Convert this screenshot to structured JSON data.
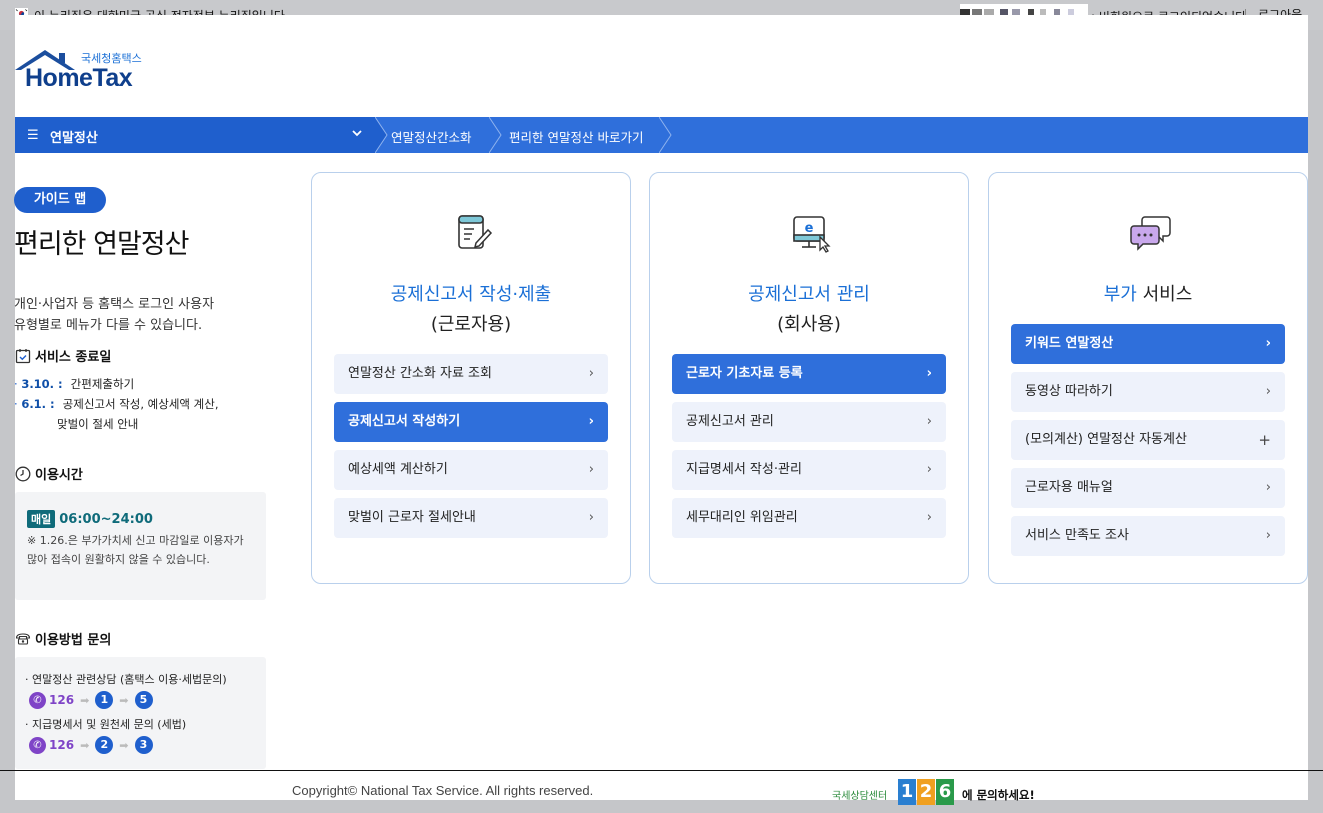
{
  "gov_bar": {
    "notice": "이 누리집은 대한민국 공식 전자정부 누리집입니다.",
    "user_status": ": 비회원으로 로그인되었습니다.",
    "logout": "로그아웃"
  },
  "logo": {
    "sub": "국세청홈택스",
    "main": "HomeTax"
  },
  "nav": {
    "menu_label": "연말정산",
    "breadcrumbs": [
      "연말정산간소화",
      "편리한 연말정산 바로가기"
    ]
  },
  "sidebar": {
    "guide_badge": "가이드 맵",
    "page_title": "편리한 연말정산",
    "intro_line1": "개인·사업자 등 홈택스 로그인 사용자",
    "intro_line2": "유형별로 메뉴가 다를 수 있습니다.",
    "service_end": {
      "heading": "서비스 종료일",
      "items": [
        {
          "date": "3.10. :",
          "text": "간편제출하기"
        },
        {
          "date": "6.1. :",
          "text": "공제신고서 작성, 예상세액 계산,",
          "text2": "맞벌이 절세 안내"
        }
      ]
    },
    "usage_time": {
      "heading": "이용시간",
      "daily_badge": "매일",
      "hours": "06:00~24:00",
      "note": "※ 1.26.은 부가가치세 신고 마감일로 이용자가 많아 접속이 원활하지 않을 수 있습니다."
    },
    "inquiry": {
      "heading": "이용방법 문의",
      "items": [
        {
          "text": "연말정산 관련상담 (홈택스 이용·세법문의)",
          "phone": "126",
          "steps": [
            "1",
            "5"
          ]
        },
        {
          "text": "지급명세서 및 원천세 문의 (세법)",
          "phone": "126",
          "steps": [
            "2",
            "3"
          ]
        }
      ]
    }
  },
  "cards": [
    {
      "icon": "document-edit-icon",
      "title_highlight": "공제신고서 작성·제출",
      "title_sub": "(근로자용)",
      "items": [
        {
          "label": "연말정산 간소화 자료 조회",
          "active": false
        },
        {
          "label": "공제신고서 작성하기",
          "active": true
        },
        {
          "label": "예상세액 계산하기",
          "active": false
        },
        {
          "label": "맞벌이 근로자 절세안내",
          "active": false
        }
      ]
    },
    {
      "icon": "monitor-e-icon",
      "title_highlight": "공제신고서 관리",
      "title_sub": "(회사용)",
      "items": [
        {
          "label": "근로자 기초자료 등록",
          "active": true
        },
        {
          "label": "공제신고서 관리",
          "active": false
        },
        {
          "label": "지급명세서 작성·관리",
          "active": false
        },
        {
          "label": "세무대리인 위임관리",
          "active": false
        }
      ]
    },
    {
      "icon": "chat-bubbles-icon",
      "title_highlight": "부가",
      "title_rest": " 서비스",
      "items": [
        {
          "label": "키워드 연말정산",
          "active": true
        },
        {
          "label": "동영상 따라하기",
          "active": false
        },
        {
          "label": "(모의계산) 연말정산 자동계산",
          "active": false,
          "plus": true
        },
        {
          "label": "근로자용 매뉴얼",
          "active": false
        },
        {
          "label": "서비스 만족도 조사",
          "active": false
        }
      ]
    }
  ],
  "footer": {
    "copyright": "Copyright© National Tax Service. All rights reserved.",
    "center_small": "국세상담센터",
    "center_digits": [
      "1",
      "2",
      "6"
    ],
    "center_tail": "에 문의하세요!"
  },
  "colors": {
    "primary": "#2f6fdb",
    "dark_primary": "#1f5fcd",
    "accent_teal": "#0f6b7a",
    "purple": "#7f44c7"
  }
}
